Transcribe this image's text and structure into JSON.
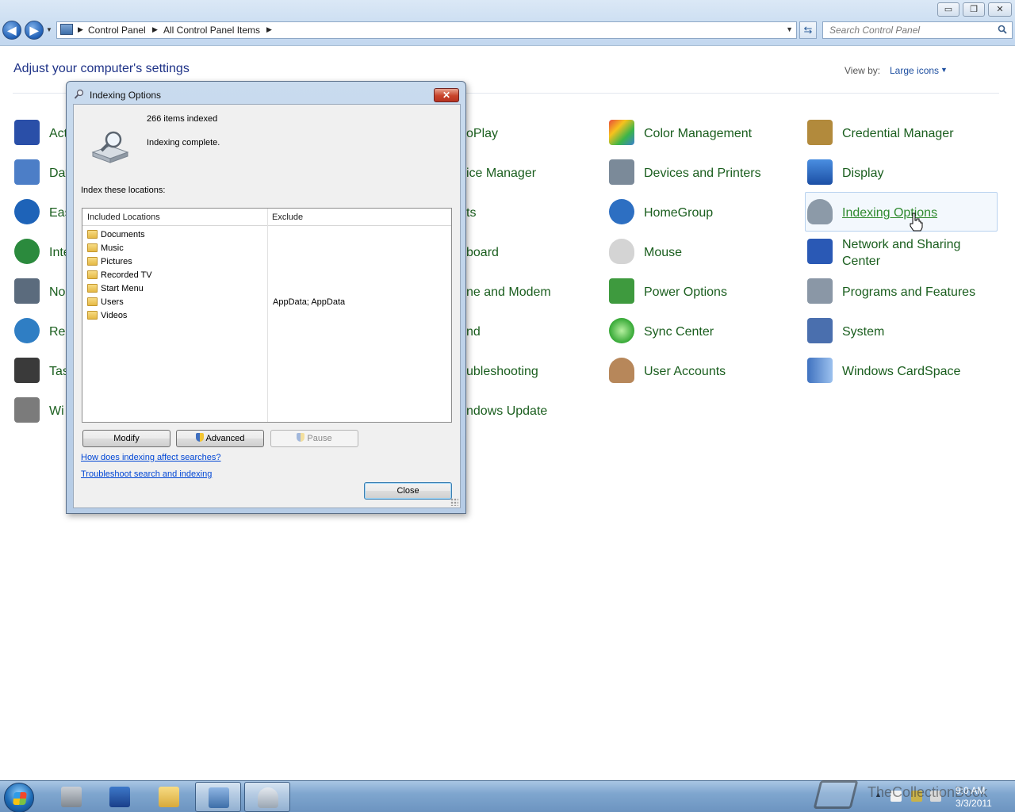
{
  "window": {
    "minimize_label": "▭",
    "maximize_label": "❐",
    "close_label": "✕"
  },
  "nav": {
    "back_label": "◀",
    "forward_label": "▶",
    "breadcrumb": [
      "Control Panel",
      "All Control Panel Items"
    ],
    "search_placeholder": "Search Control Panel"
  },
  "header": {
    "title": "Adjust your computer's settings",
    "view_by_label": "View by:",
    "view_by_value": "Large icons"
  },
  "items": [
    {
      "label": "Action Center",
      "icon": "flag-icon",
      "color": "#2a4fa8",
      "visible": "Act"
    },
    {
      "label": "Date and Time",
      "icon": "calendar-clock-icon",
      "color": "#4c7ec7",
      "visible": "Dat"
    },
    {
      "label": "Ease of Access Center",
      "icon": "ease-of-access-icon",
      "color": "#1e63b8",
      "visible": "Eas"
    },
    {
      "label": "Internet Options",
      "icon": "globe-checklist-icon",
      "color": "#2b8a3d",
      "visible": "Inte"
    },
    {
      "label": "Notification Area Icons",
      "icon": "tray-icon",
      "color": "#5b6b7d",
      "visible": "No"
    },
    {
      "label": "Region and Language",
      "icon": "globe-clock-icon",
      "color": "#2f7ec4",
      "visible": "Reg"
    },
    {
      "label": "Taskbar and Start Menu",
      "icon": "taskbar-icon",
      "color": "#3a3a3a",
      "visible": "Tas"
    },
    {
      "label": "Windows Firewall",
      "icon": "firewall-icon",
      "color": "#7b7b7b",
      "visible": "Wi"
    },
    {
      "label": "AutoPlay",
      "visible": "oPlay"
    },
    {
      "label": "Device Manager",
      "visible": "ice Manager"
    },
    {
      "label": "Fonts",
      "visible": "ts"
    },
    {
      "label": "Keyboard",
      "visible": "board"
    },
    {
      "label": "Phone and Modem",
      "visible": "ne and Modem"
    },
    {
      "label": "Sound",
      "visible": "nd"
    },
    {
      "label": "Troubleshooting",
      "visible": "ubleshooting"
    },
    {
      "label": "Windows Update",
      "visible": "ndows Update"
    },
    {
      "label": "Color Management",
      "icon": "color-management-icon",
      "color": "#3b7fd0"
    },
    {
      "label": "Devices and Printers",
      "icon": "printer-icon",
      "color": "#7b8a99"
    },
    {
      "label": "HomeGroup",
      "icon": "homegroup-icon",
      "color": "#2d6fc2"
    },
    {
      "label": "Mouse",
      "icon": "mouse-icon",
      "color": "#b9b9b9"
    },
    {
      "label": "Power Options",
      "icon": "power-options-icon",
      "color": "#3e9a3e"
    },
    {
      "label": "Sync Center",
      "icon": "sync-icon",
      "color": "#35a835"
    },
    {
      "label": "User Accounts",
      "icon": "users-icon",
      "color": "#b7875a"
    },
    {
      "label": "Credential Manager",
      "icon": "vault-icon",
      "color": "#b28a3c"
    },
    {
      "label": "Display",
      "icon": "display-icon",
      "color": "#2462c0"
    },
    {
      "label": "Indexing Options",
      "icon": "indexing-icon",
      "color": "#8c9aa8"
    },
    {
      "label": "Network and Sharing Center",
      "icon": "network-icon",
      "color": "#2a59b5"
    },
    {
      "label": "Programs and Features",
      "icon": "programs-icon",
      "color": "#8a97a6"
    },
    {
      "label": "System",
      "icon": "system-icon",
      "color": "#4a6fae"
    },
    {
      "label": "Windows CardSpace",
      "icon": "cardspace-icon",
      "color": "#3f72c0"
    }
  ],
  "dialog": {
    "title": "Indexing Options",
    "items_indexed": "266 items indexed",
    "status": "Indexing complete.",
    "locations_label": "Index these locations:",
    "col_included": "Included Locations",
    "col_exclude": "Exclude",
    "locations": [
      {
        "name": "Documents",
        "exclude": ""
      },
      {
        "name": "Music",
        "exclude": ""
      },
      {
        "name": "Pictures",
        "exclude": ""
      },
      {
        "name": "Recorded TV",
        "exclude": ""
      },
      {
        "name": "Start Menu",
        "exclude": ""
      },
      {
        "name": "Users",
        "exclude": "AppData; AppData"
      },
      {
        "name": "Videos",
        "exclude": ""
      }
    ],
    "modify_label": "Modify",
    "advanced_label": "Advanced",
    "pause_label": "Pause",
    "link_how": "How does indexing affect searches?",
    "link_troubleshoot": "Troubleshoot search and indexing",
    "close_label": "Close",
    "close_x": "✕"
  },
  "taskbar": {
    "buttons": [
      {
        "icon": "server-manager-icon"
      },
      {
        "icon": "powershell-icon"
      },
      {
        "icon": "explorer-icon"
      },
      {
        "icon": "control-panel-icon"
      },
      {
        "icon": "indexing-options-icon"
      }
    ],
    "clock_time": "9:0 AM",
    "clock_date": "3/3/2011",
    "watermark": "TheCollectionBook"
  }
}
